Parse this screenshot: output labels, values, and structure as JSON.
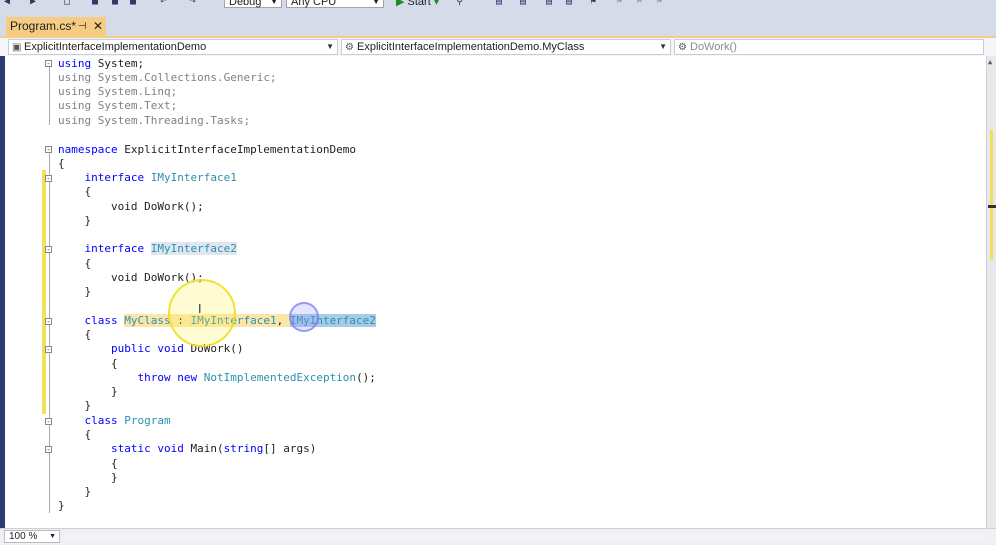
{
  "toolbar": {
    "config": "Debug",
    "platform": "Any CPU",
    "start_label": "Start"
  },
  "tab": {
    "title": "Program.cs*",
    "pin_icon": "pin-icon",
    "close_icon": "close-icon"
  },
  "navbar": {
    "project": "ExplicitInterfaceImplementationDemo",
    "type": "ExplicitInterfaceImplementationDemo.MyClass",
    "member": "DoWork()"
  },
  "code": {
    "l1": "System;",
    "l2": "System.Collections.Generic;",
    "l3": "System.Linq;",
    "l4": "System.Text;",
    "l5": "System.Threading.Tasks;",
    "ns": "ExplicitInterfaceImplementationDemo",
    "iface1": "IMyInterface1",
    "iface2": "IMyInterface2",
    "dowork_decl": "void DoWork();",
    "myclass": "MyClass",
    "method_sig": "public void DoWork()",
    "exception": "NotImplementedException",
    "program": "Program",
    "main_sig": "static void Main(string[] args)"
  },
  "status": {
    "zoom": "100 %"
  },
  "colors": {
    "keyword": "#0000ff",
    "type": "#2b91af",
    "tab_active": "#f5cc84",
    "change_marker": "#f2df5a"
  }
}
